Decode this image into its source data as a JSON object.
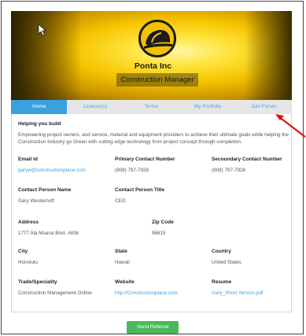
{
  "profile": {
    "company_name": "Ponta Inc",
    "role": "Construction Manager"
  },
  "tabs": [
    {
      "label": "Home",
      "active": true
    },
    {
      "label": "Licence(s)",
      "active": false
    },
    {
      "label": "Terms",
      "active": false
    },
    {
      "label": "My Portfolio",
      "active": false
    },
    {
      "label": "Join Forum",
      "active": false
    }
  ],
  "about": {
    "heading": "Helping you build",
    "text": "Empowering project owners, and service, material and equipment providers to achieve their ultimate goals while helping the Construction Industry go Green with cutting edge technology from project concept through completion."
  },
  "fields": {
    "email_label": "Email Id",
    "email": "garyw@constructionplace.com",
    "primary_label": "Primary Contact Number",
    "primary": "(808) 797-7928",
    "secondary_label": "Secoundary Contact Number",
    "secondary": "(808) 797-7928",
    "contact_name_label": "Contact Person Name",
    "contact_name": "Gary Westernoff",
    "contact_title_label": "Contact Person Title",
    "contact_title": "CEO",
    "address_label": "Address",
    "address": "1777 Ala Moana Blvd, #836",
    "zip_label": "Zip Code",
    "zip": "96815",
    "city_label": "City",
    "city": "Honolulu",
    "state_label": "State",
    "state": "Hawaii",
    "country_label": "Country",
    "country": "United States",
    "trade_label": "Trade/Speciality",
    "trade": "Construction Management Online",
    "website_label": "Website",
    "website": "http://Constructionplace.com",
    "resume_label": "Resume",
    "resume": "Gary_Short Version.pdf"
  },
  "actions": {
    "referral_label": "Send Referral"
  },
  "colors": {
    "accent": "#3aa0de",
    "button_green": "#4cb85c",
    "hero_yellow": "#f5c400",
    "annotation_red": "#e01010"
  },
  "icons": {
    "logo": "hard-hat-logo",
    "cursor": "mouse-cursor-icon",
    "annotation": "red-arrow-icon"
  }
}
